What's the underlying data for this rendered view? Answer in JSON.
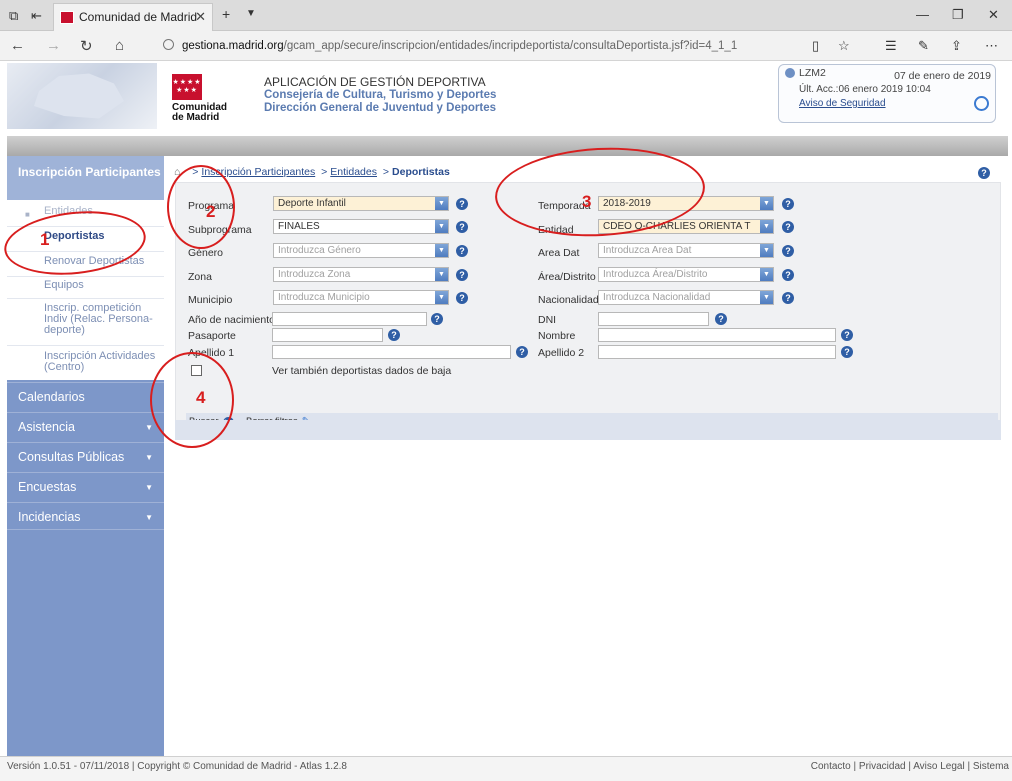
{
  "browser": {
    "tab_title": "Comunidad de Madrid",
    "url_host": "gestiona.madrid.org",
    "url_path": "/gcam_app/secure/inscripcion/entidades/incripdeportista/consultaDeportista.jsf?id=4_1_1"
  },
  "header": {
    "logo_text": "Comunidad de Madrid",
    "app_line1": "APLICACIÓN DE GESTIÓN DEPORTIVA",
    "app_line2": "Consejería de Cultura, Turismo y Deportes",
    "app_line3": "Dirección General de Juventud y Deportes",
    "user": "LZM2",
    "date": "07 de enero de 2019",
    "last_access": "Últ. Acc.:06 enero 2019 10:04",
    "security_notice": "Aviso de Seguridad"
  },
  "sidebar": {
    "header": "Inscripción Participantes",
    "items": [
      {
        "label": "Entidades"
      },
      {
        "label": "Deportistas"
      },
      {
        "label": "Renovar Deportistas"
      },
      {
        "label": "Equipos"
      },
      {
        "label": "Inscrip. competición Indiv (Relac. Persona-deporte)"
      },
      {
        "label": "Inscripción Actividades (Centro)"
      }
    ],
    "menus": [
      {
        "label": "Calendarios"
      },
      {
        "label": "Asistencia"
      },
      {
        "label": "Consultas Públicas"
      },
      {
        "label": "Encuestas"
      },
      {
        "label": "Incidencias"
      }
    ]
  },
  "breadcrumb": {
    "items": [
      "Inscripción Participantes",
      "Entidades"
    ],
    "current": "Deportistas",
    "separator": ">"
  },
  "form": {
    "programa": {
      "label": "Programa",
      "value": "Deporte Infantil"
    },
    "subprograma": {
      "label": "Subprograma",
      "value": "FINALES"
    },
    "genero": {
      "label": "Género",
      "placeholder": "Introduzca Género"
    },
    "zona": {
      "label": "Zona",
      "placeholder": "Introduzca Zona"
    },
    "municipio": {
      "label": "Municipio",
      "placeholder": "Introduzca Municipio"
    },
    "anio_nacimiento": {
      "label": "Año de nacimiento"
    },
    "pasaporte": {
      "label": "Pasaporte"
    },
    "apellido1": {
      "label": "Apellido 1"
    },
    "temporada": {
      "label": "Temporada",
      "value": "2018-2019"
    },
    "entidad": {
      "label": "Entidad",
      "value": "CDEO O-CHARLIES ORIENTA T"
    },
    "area_dat": {
      "label": "Area Dat",
      "placeholder": "Introduzca Area Dat"
    },
    "area_distrito": {
      "label": "Área/Distrito",
      "placeholder": "Introduzca Área/Distrito"
    },
    "nacionalidad": {
      "label": "Nacionalidad",
      "placeholder": "Introduzca Nacionalidad"
    },
    "dni": {
      "label": "DNI"
    },
    "nombre": {
      "label": "Nombre"
    },
    "apellido2": {
      "label": "Apellido 2"
    },
    "baja_checkbox": {
      "label": "Ver también deportistas dados de baja"
    },
    "buscar": "Buscar",
    "borrar": "Borrar filtros"
  },
  "annotations": {
    "n1": "1",
    "n2": "2",
    "n3": "3",
    "n4": "4",
    "color": "#d81e1e"
  },
  "footer": {
    "left": "Versión 1.0.51 - 07/11/2018 | Copyright © Comunidad de Madrid - Atlas 1.2.8",
    "right": "Contacto | Privacidad | Aviso Legal | Sistema"
  }
}
